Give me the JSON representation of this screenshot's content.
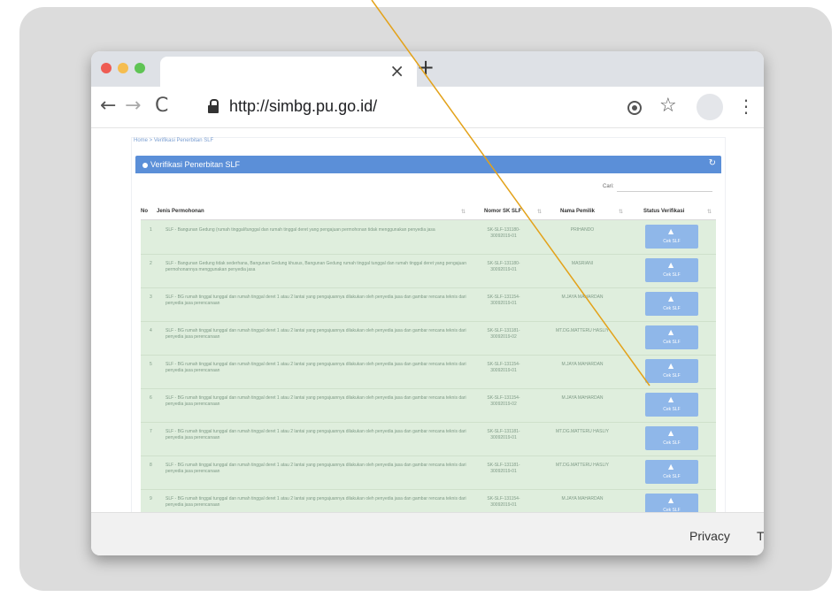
{
  "browser": {
    "tab_close": "×",
    "new_tab": "+",
    "back": "←",
    "forward": "→",
    "reload": "C",
    "url": "http://simbg.pu.go.id/",
    "star": "☆",
    "menu": "⋮"
  },
  "page": {
    "breadcrumb": "Home > Verifikasi Penerbitan SLF",
    "panel_title": "Verifikasi Penerbitan SLF",
    "refresh": "↻",
    "search_label": "Cari:",
    "columns": {
      "no": "No",
      "jenis": "Jenis Permohonan",
      "sk": "Nomor SK SLF",
      "owner": "Nama Pemilik",
      "status": "Status Verifikasi"
    },
    "button_label": "Cek SLF",
    "rows": [
      {
        "no": "1",
        "jenis": "SLF - Bangunan Gedung (rumah tinggal/tunggal dan rumah tinggal deret yang pengajuan permohonan tidak menggunakan penyedia jasa",
        "sk": "SK-SLF-131180-30092019-01",
        "owner": "PRIHANDO"
      },
      {
        "no": "2",
        "jenis": "SLF - Bangunan Gedung tidak sederhana, Bangunan Gedung khusus, Bangunan Gedung rumah tinggal tunggal dan rumah tinggal deret yang pengajuan permohonannya menggunakan penyedia jasa",
        "sk": "SK-SLF-131180-30092019-01",
        "owner": "MASRIANI"
      },
      {
        "no": "3",
        "jenis": "SLF - BG rumah tinggal tunggal dan rumah tinggal deret 1 atau 2 lantai yang pengajuannya dilakukan oleh penyedia jasa dan gambar rencana teknis dari penyedia jasa perencanaan",
        "sk": "SK-SLF-131154-30092019-01",
        "owner": "M.JAYA MAHARDAN"
      },
      {
        "no": "4",
        "jenis": "SLF - BG rumah tinggal tunggal dan rumah tinggal deret 1 atau 2 lantai yang pengajuannya dilakukan oleh penyedia jasa dan gambar rencana teknis dari penyedia jasa perencanaan",
        "sk": "SK-SLF-131181-30092019-02",
        "owner": "MT.DG.MATTERU HASLIY"
      },
      {
        "no": "5",
        "jenis": "SLF - BG rumah tinggal tunggal dan rumah tinggal deret 1 atau 2 lantai yang pengajuannya dilakukan oleh penyedia jasa dan gambar rencana teknis dari penyedia jasa perencanaan",
        "sk": "SK-SLF-131154-30092019-01",
        "owner": "M.JAYA MAHARDAN"
      },
      {
        "no": "6",
        "jenis": "SLF - BG rumah tinggal tunggal dan rumah tinggal deret 1 atau 2 lantai yang pengajuannya dilakukan oleh penyedia jasa dan gambar rencana teknis dari penyedia jasa perencanaan",
        "sk": "SK-SLF-131154-30092019-02",
        "owner": "M.JAYA MAHARDAN"
      },
      {
        "no": "7",
        "jenis": "SLF - BG rumah tinggal tunggal dan rumah tinggal deret 1 atau 2 lantai yang pengajuannya dilakukan oleh penyedia jasa dan gambar rencana teknis dari penyedia jasa perencanaan",
        "sk": "SK-SLF-131181-30092019-01",
        "owner": "MT.DG.MATTERU HASLIY"
      },
      {
        "no": "8",
        "jenis": "SLF - BG rumah tinggal tunggal dan rumah tinggal deret 1 atau 2 lantai yang pengajuannya dilakukan oleh penyedia jasa dan gambar rencana teknis dari penyedia jasa perencanaan",
        "sk": "SK-SLF-131181-30092019-01",
        "owner": "MT.DG.MATTERU HASLIY"
      },
      {
        "no": "9",
        "jenis": "SLF - BG rumah tinggal tunggal dan rumah tinggal deret 1 atau 2 lantai yang pengajuannya dilakukan oleh penyedia jasa dan gambar rencana teknis dari penyedia jasa perencanaan",
        "sk": "SK-SLF-131154-30092019-01",
        "owner": "M.JAYA MAHARDAN"
      }
    ]
  },
  "footer": {
    "privacy": "Privacy",
    "terms_clipped": "T"
  },
  "colors": {
    "panel_header": "#5b8fd8",
    "row_background": "#dfeedd",
    "button": "#8fb7e9",
    "pointer_line": "#e3a21a"
  }
}
